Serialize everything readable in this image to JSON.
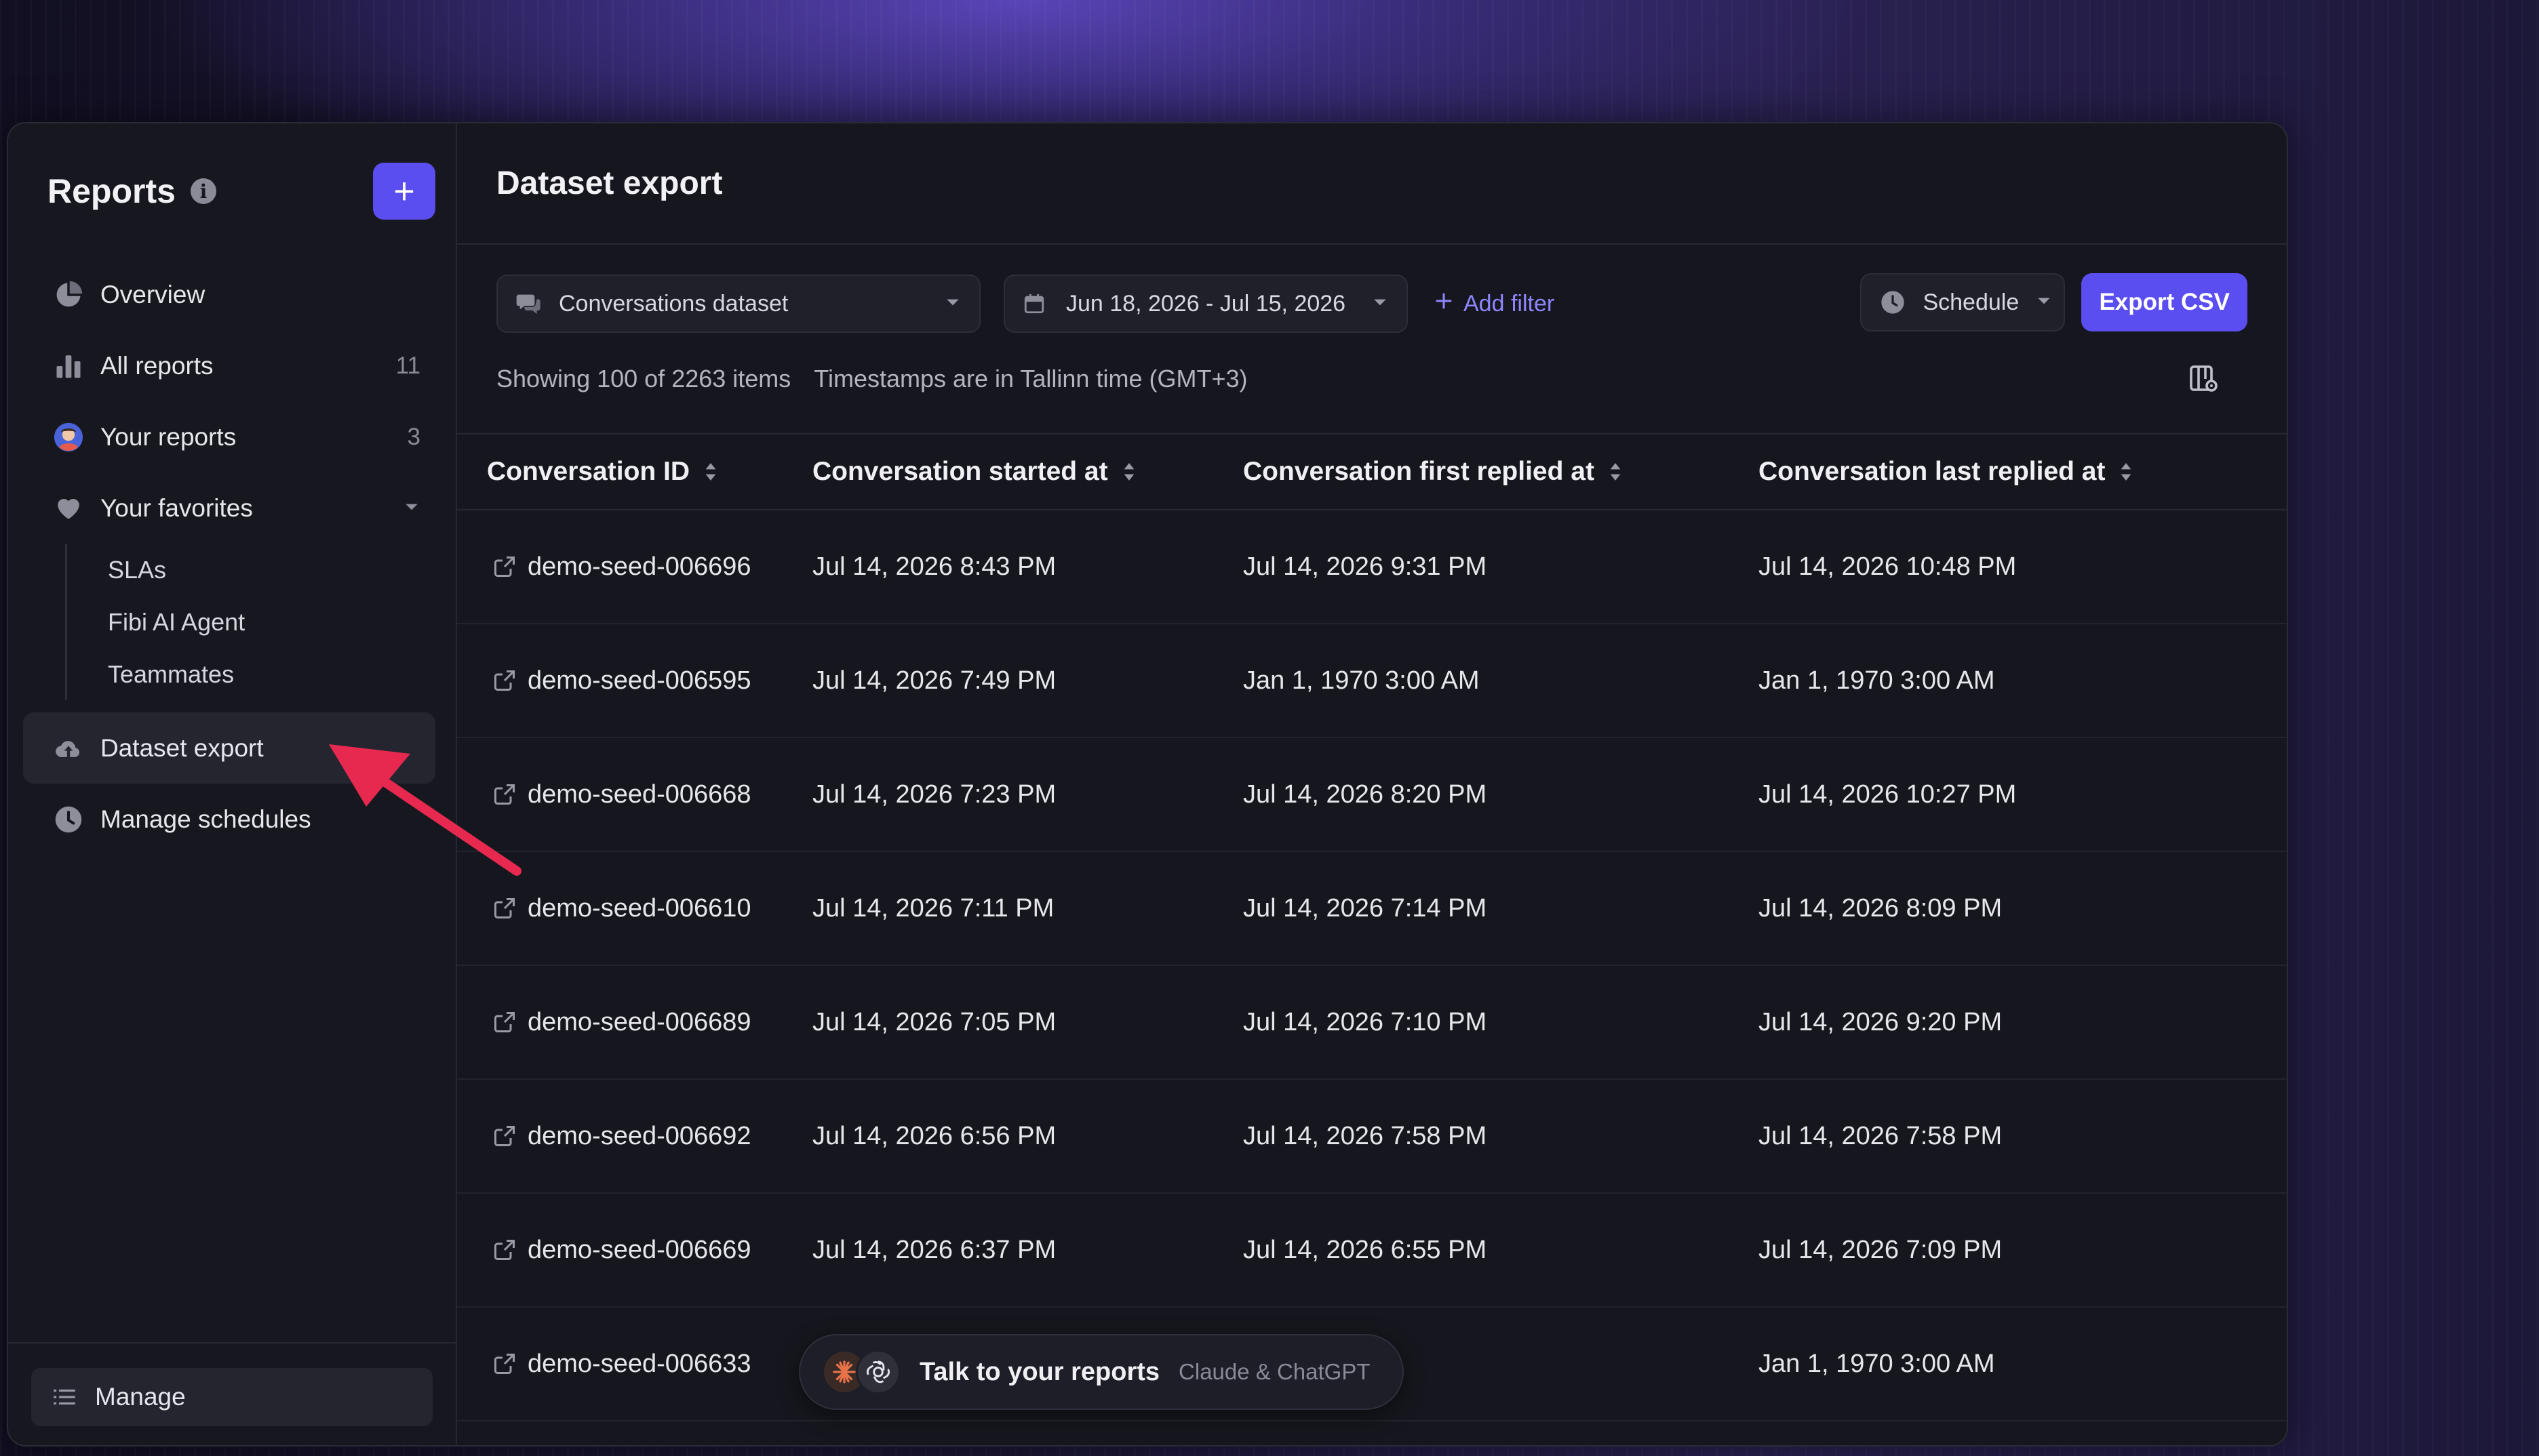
{
  "sidebar": {
    "title": "Reports",
    "info_label": "i",
    "add_label": "+",
    "items": [
      {
        "label": "Overview",
        "icon": "pie-chart-icon",
        "count": ""
      },
      {
        "label": "All reports",
        "icon": "bar-chart-icon",
        "count": "11"
      },
      {
        "label": "Your reports",
        "icon": "avatar-icon",
        "count": "3"
      },
      {
        "label": "Your favorites",
        "icon": "heart-icon",
        "count": ""
      }
    ],
    "favorites": [
      "SLAs",
      "Fibi AI Agent",
      "Teammates"
    ],
    "dataset_export": {
      "label": "Dataset export",
      "icon": "cloud-upload-icon"
    },
    "manage_schedules": {
      "label": "Manage schedules",
      "icon": "clock-icon"
    },
    "footer": {
      "manage_label": "Manage",
      "icon": "list-icon"
    }
  },
  "main": {
    "title": "Dataset export",
    "toolbar": {
      "dataset_select": "Conversations dataset",
      "date_range": "Jun 18, 2026 - Jul 15, 2026",
      "add_filter": "Add filter",
      "schedule": "Schedule",
      "export": "Export CSV"
    },
    "info": {
      "showing": "Showing 100 of 2263 items",
      "timezone": "Timestamps are in Tallinn time (GMT+3)"
    },
    "table": {
      "columns": [
        "Conversation ID",
        "Conversation started at",
        "Conversation first replied at",
        "Conversation last replied at"
      ],
      "rows": [
        [
          "demo-seed-006696",
          "Jul 14, 2026 8:43 PM",
          "Jul 14, 2026 9:31 PM",
          "Jul 14, 2026 10:48 PM"
        ],
        [
          "demo-seed-006595",
          "Jul 14, 2026 7:49 PM",
          "Jan 1, 1970 3:00 AM",
          "Jan 1, 1970 3:00 AM"
        ],
        [
          "demo-seed-006668",
          "Jul 14, 2026 7:23 PM",
          "Jul 14, 2026 8:20 PM",
          "Jul 14, 2026 10:27 PM"
        ],
        [
          "demo-seed-006610",
          "Jul 14, 2026 7:11 PM",
          "Jul 14, 2026 7:14 PM",
          "Jul 14, 2026 8:09 PM"
        ],
        [
          "demo-seed-006689",
          "Jul 14, 2026 7:05 PM",
          "Jul 14, 2026 7:10 PM",
          "Jul 14, 2026 9:20 PM"
        ],
        [
          "demo-seed-006692",
          "Jul 14, 2026 6:56 PM",
          "Jul 14, 2026 7:58 PM",
          "Jul 14, 2026 7:58 PM"
        ],
        [
          "demo-seed-006669",
          "Jul 14, 2026 6:37 PM",
          "Jul 14, 2026 6:55 PM",
          "Jul 14, 2026 7:09 PM"
        ],
        [
          "demo-seed-006633",
          "",
          "3:00 AM",
          "Jan 1, 1970 3:00 AM"
        ]
      ]
    }
  },
  "pill": {
    "title": "Talk to your reports",
    "subtitle": "Claude & ChatGPT"
  },
  "colors": {
    "accent": "#5b4ef0",
    "link": "#8f86ff",
    "arrow": "#e8294f"
  }
}
